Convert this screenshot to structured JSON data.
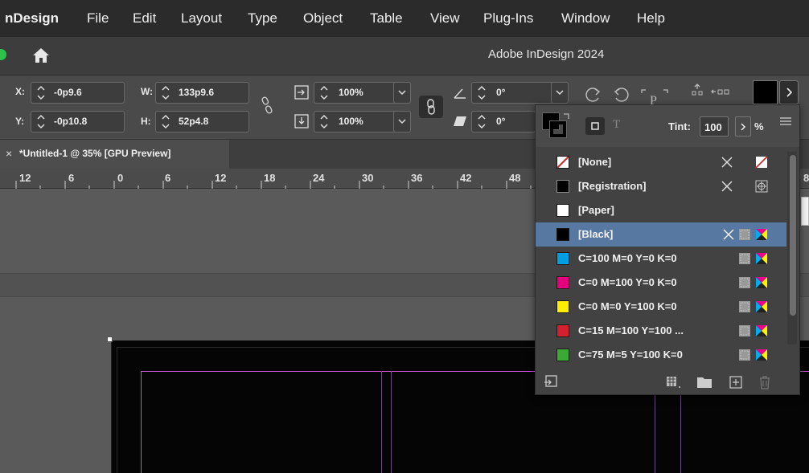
{
  "menubar": {
    "app": "nDesign",
    "items": [
      "File",
      "Edit",
      "Layout",
      "Type",
      "Object",
      "Table",
      "View",
      "Plug-Ins",
      "Window",
      "Help"
    ]
  },
  "window": {
    "title": "Adobe InDesign 2024"
  },
  "control": {
    "x_label": "X:",
    "x_value": "-0p9.6",
    "y_label": "Y:",
    "y_value": "-0p10.8",
    "w_label": "W:",
    "w_value": "133p9.6",
    "h_label": "H:",
    "h_value": "52p4.8",
    "scale_x": "100%",
    "scale_y": "100%",
    "rotate": "0°",
    "shear": "0°"
  },
  "document_tab": {
    "close": "×",
    "name": "*Untitled-1 @ 35% [GPU Preview]"
  },
  "ruler": {
    "ticks": [
      "12",
      "6",
      "0",
      "6",
      "12",
      "18",
      "24",
      "30",
      "36",
      "42",
      "48",
      "8"
    ]
  },
  "swatches_panel": {
    "tint_label": "Tint:",
    "tint_value": "100",
    "percent": "%",
    "selected_index": 3,
    "swatches": [
      {
        "name": "[None]",
        "color": "#ffffff",
        "type": "none"
      },
      {
        "name": "[Registration]",
        "color": "#000000",
        "type": "registration"
      },
      {
        "name": "[Paper]",
        "color": "#ffffff",
        "type": "paper"
      },
      {
        "name": "[Black]",
        "color": "#000000",
        "type": "black"
      },
      {
        "name": "C=100 M=0 Y=0 K=0",
        "color": "#009fe3",
        "type": "process"
      },
      {
        "name": "C=0 M=100 Y=0 K=0",
        "color": "#e5007e",
        "type": "process"
      },
      {
        "name": "C=0 M=0 Y=100 K=0",
        "color": "#ffed00",
        "type": "process"
      },
      {
        "name": "C=15 M=100 Y=100 ...",
        "color": "#d2202f",
        "type": "process"
      },
      {
        "name": "C=75 M=5 Y=100 K=0",
        "color": "#3aaa35",
        "type": "process"
      }
    ]
  },
  "colors": {
    "accent_selection": "#5778a0",
    "page_margin_guide": "#c255c9",
    "document_page": "#050505"
  }
}
